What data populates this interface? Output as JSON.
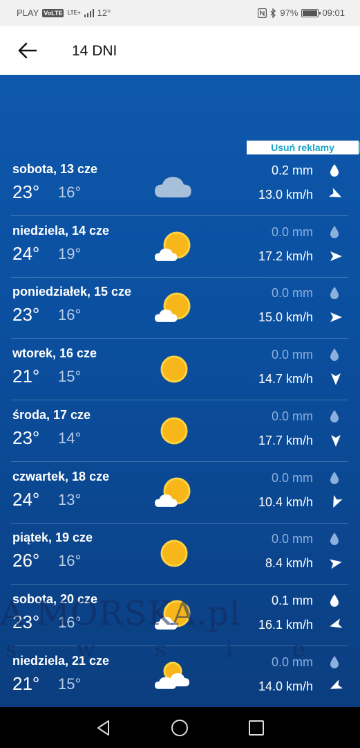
{
  "status": {
    "carrier": "PLAY",
    "volte": "VoLTE",
    "lte": "LTE+",
    "temp": "12°",
    "battery": "97%",
    "time": "09:01",
    "battery_fraction": 0.97
  },
  "appbar": {
    "title": "14 DNI"
  },
  "ad": {
    "label": "Usuń reklamy"
  },
  "days": [
    {
      "day": "sobota, 13 cze",
      "tmax": "23°",
      "tmin": "16°",
      "rain": "0.2 mm",
      "rain_active": true,
      "wind": "13.0 km/h",
      "icon": "cloud-icon",
      "wind_dir": 115
    },
    {
      "day": "niedziela, 14 cze",
      "tmax": "24°",
      "tmin": "19°",
      "rain": "0.0 mm",
      "rain_active": false,
      "wind": "17.2 km/h",
      "icon": "sun-cloud-icon",
      "wind_dir": 90
    },
    {
      "day": "poniedziałek, 15 cze",
      "tmax": "23°",
      "tmin": "16°",
      "rain": "0.0 mm",
      "rain_active": false,
      "wind": "15.0 km/h",
      "icon": "sun-cloud-icon",
      "wind_dir": 90
    },
    {
      "day": "wtorek, 16 cze",
      "tmax": "21°",
      "tmin": "15°",
      "rain": "0.0 mm",
      "rain_active": false,
      "wind": "14.7 km/h",
      "icon": "sun-icon",
      "wind_dir": 180
    },
    {
      "day": "środa, 17 cze",
      "tmax": "23°",
      "tmin": "14°",
      "rain": "0.0 mm",
      "rain_active": false,
      "wind": "17.7 km/h",
      "icon": "sun-icon",
      "wind_dir": 180
    },
    {
      "day": "czwartek, 18 cze",
      "tmax": "24°",
      "tmin": "13°",
      "rain": "0.0 mm",
      "rain_active": false,
      "wind": "10.4 km/h",
      "icon": "sun-cloud-icon",
      "wind_dir": 205
    },
    {
      "day": "piątek, 19 cze",
      "tmax": "26°",
      "tmin": "16°",
      "rain": "0.0 mm",
      "rain_active": false,
      "wind": "8.4 km/h",
      "icon": "sun-icon",
      "wind_dir": 80
    },
    {
      "day": "sobota, 20 cze",
      "tmax": "23°",
      "tmin": "16°",
      "rain": "0.1 mm",
      "rain_active": true,
      "wind": "16.1 km/h",
      "icon": "sun-cloud-icon",
      "wind_dir": 255
    },
    {
      "day": "niedziela, 21 cze",
      "tmax": "21°",
      "tmin": "15°",
      "rain": "0.0 mm",
      "rain_active": false,
      "wind": "14.0 km/h",
      "icon": "sun-clouds-icon",
      "wind_dir": 245
    }
  ],
  "watermark": {
    "big": "A MORSKA.pl",
    "small": "s w s i e c i"
  },
  "colors": {
    "sun": "#f7b71b",
    "sun_edge": "#ffd23f",
    "cloud": "#a7bfd9",
    "accent": "#1aa4c7"
  }
}
